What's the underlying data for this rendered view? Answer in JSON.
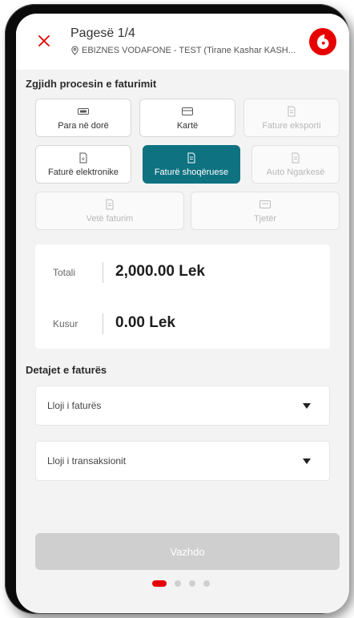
{
  "header": {
    "title": "Pagesë 1/4",
    "subtitle": "EBIZNES VODAFONE - TEST (Tirane Kashar KASH..."
  },
  "process": {
    "title": "Zgjidh procesin e faturimit",
    "options": [
      {
        "label": "Para në dorë"
      },
      {
        "label": "Kartë"
      },
      {
        "label": "Fature eksporti"
      },
      {
        "label": "Faturë elektronike"
      },
      {
        "label": "Faturë shoqëruese"
      },
      {
        "label": "Auto Ngarkesë"
      },
      {
        "label": "Vetë faturim"
      },
      {
        "label": "Tjetër"
      }
    ]
  },
  "totals": {
    "total_label": "Totali",
    "total_value": "2,000.00 Lek",
    "change_label": "Kusur",
    "change_value": "0.00 Lek"
  },
  "details": {
    "title": "Detajet e faturës",
    "invoice_type_label": "Lloji i faturës",
    "transaction_type_label": "Lloji i transaksionit"
  },
  "continue_label": "Vazhdo",
  "pager": {
    "current": 1,
    "total": 4
  },
  "colors": {
    "accent": "#0e7281",
    "brand": "#e60000",
    "disabled": "#cfcfcf"
  }
}
